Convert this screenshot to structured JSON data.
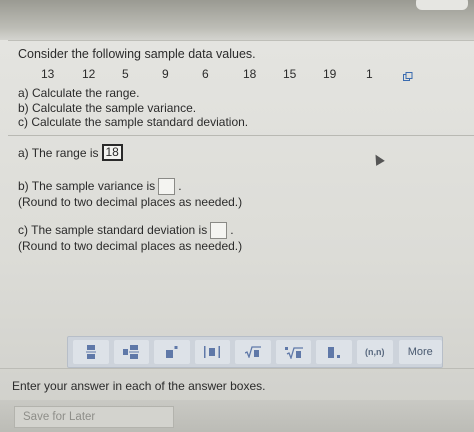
{
  "question": {
    "prompt": "Consider the following sample data values.",
    "values": [
      "13",
      "12",
      "5",
      "9",
      "6",
      "18",
      "15",
      "19",
      "1"
    ],
    "tasks": [
      "a) Calculate the range.",
      "b) Calculate the sample variance.",
      "c) Calculate the sample standard deviation."
    ]
  },
  "answers": {
    "a": {
      "label": "a) The range is",
      "value": "18"
    },
    "b": {
      "label": "b) The sample variance is",
      "value": "",
      "suffix": ".",
      "note": "(Round to two decimal places as needed.)"
    },
    "c": {
      "label": "c) The sample standard deviation is",
      "value": "",
      "suffix": ".",
      "note": "(Round to two decimal places as needed.)"
    }
  },
  "toolbar": {
    "buttons": [
      "fraction-icon",
      "mixed-number-icon",
      "exponent-icon",
      "absolute-value-icon",
      "square-root-icon",
      "nth-root-icon",
      "decimal-icon",
      "interval-icon"
    ],
    "interval_label": "(n,n)",
    "more_label": "More"
  },
  "footer": {
    "hint": "Enter your answer in each of the answer boxes.",
    "save_label": "Save for Later"
  },
  "colors": {
    "toolbar_bg": "#cdd3db",
    "answer_box_border": "#3a6bb0",
    "panel_bg": "#e0e0dc"
  }
}
